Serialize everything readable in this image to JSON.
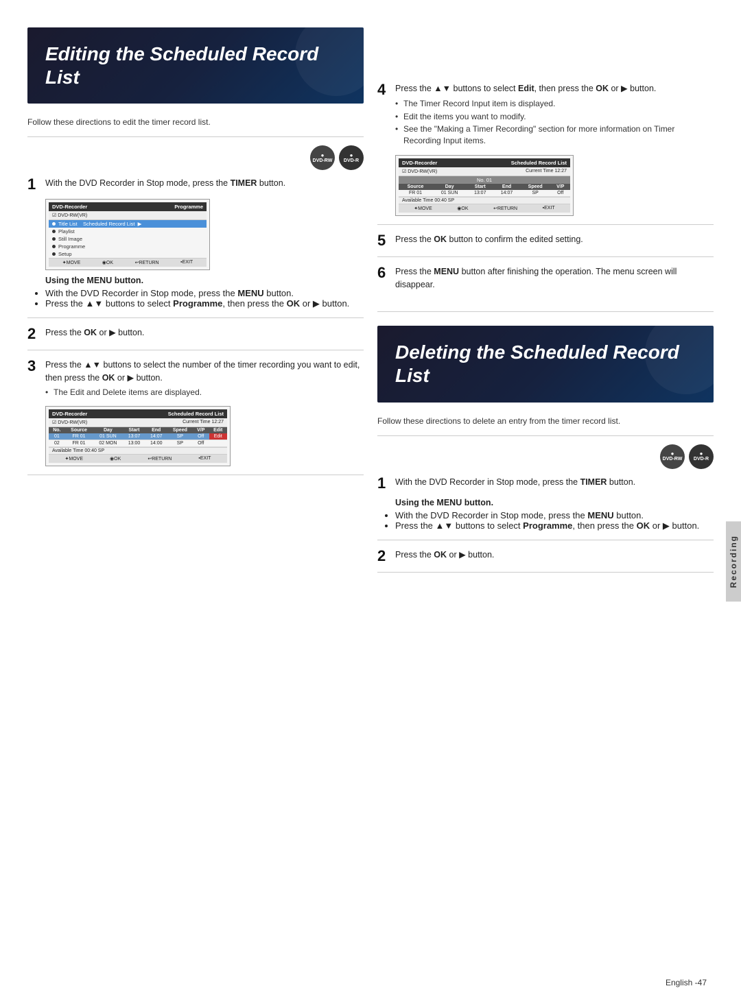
{
  "left": {
    "section_title": "Editing the Scheduled Record List",
    "intro": "Follow these directions to edit the timer record list.",
    "steps": [
      {
        "number": "1",
        "text": "With the DVD Recorder in Stop mode, press the ",
        "bold": "TIMER",
        "text2": " button."
      },
      {
        "number": "2",
        "text": "Press the ",
        "bold": "OK",
        "text2": " or ▶ button."
      },
      {
        "number": "3",
        "text": "Press the ▲▼ buttons to select the number of the timer recording you want to edit, then press the ",
        "bold": "OK",
        "text2": " or ▶ button.",
        "bullet": "The Edit and Delete items are displayed."
      }
    ],
    "using_menu": {
      "title": "Using the MENU button.",
      "bullets": [
        "With the DVD Recorder in Stop mode, press the MENU button.",
        "Press the ▲▼ buttons to select Programme, then press the OK or ▶ button."
      ]
    },
    "screen1": {
      "header_left": "DVD-Recorder",
      "header_right": "Programme",
      "subheader": "DVD-RW(VR)",
      "menu_items": [
        {
          "label": "Title List",
          "sub": "Scheduled Record List",
          "selected": true
        },
        {
          "label": "Playlist"
        },
        {
          "label": "Still Image"
        },
        {
          "label": "Programme"
        },
        {
          "label": "Setup"
        }
      ],
      "footer": [
        "MOVE",
        "OK",
        "RETURN",
        "EXIT"
      ]
    },
    "screen2": {
      "header_left": "DVD-Recorder",
      "header_right": "Scheduled Record List",
      "subheader_left": "DVD-RW(VR)",
      "subheader_right": "Current Time 12:27",
      "columns": [
        "No.",
        "Source",
        "Day",
        "Start",
        "End",
        "Speed",
        "V/P",
        "Edit"
      ],
      "rows": [
        [
          "01",
          "FR 01",
          "01 SUN",
          "13:07",
          "14:07",
          "SP",
          "Off",
          "Edit"
        ],
        [
          "02",
          "FR 01",
          "02 MON",
          "13:00",
          "14:00",
          "SP",
          "Off",
          ""
        ]
      ],
      "available": "Available Time 00:40 SP",
      "footer": [
        "MOVE",
        "OK",
        "RETURN",
        "EXIT"
      ]
    }
  },
  "right": {
    "steps_top": [
      {
        "number": "4",
        "text": "Press the ▲▼ buttons to select ",
        "bold": "Edit",
        "text2": ", then press the ",
        "bold2": "OK",
        "text3": " or ▶ button.",
        "bullets": [
          "The Timer Record Input item is displayed.",
          "Edit the items you want to modify.",
          "See the \"Making a Timer Recording\" section for more information on Timer Recording Input items."
        ]
      },
      {
        "number": "5",
        "text": "Press the ",
        "bold": "OK",
        "text2": " button to confirm the edited setting."
      },
      {
        "number": "6",
        "text": "Press the ",
        "bold": "MENU",
        "text2": " button after finishing the operation. The menu screen will disappear."
      }
    ],
    "screen3": {
      "header_left": "DVD-Recorder",
      "header_right": "Scheduled Record List",
      "subheader_left": "DVD-RW(VR)",
      "subheader_right": "Current Time 12:27",
      "no_label": "No. 01",
      "columns": [
        "Source",
        "Day",
        "Start",
        "End",
        "Speed",
        "V/P"
      ],
      "row": [
        "FR 01",
        "01 SUN",
        "13:07",
        "14:07",
        "SP",
        "Off"
      ],
      "available": "Available Time 00:40 SP",
      "footer": [
        "MOVE",
        "OK",
        "RETURN",
        "EXIT"
      ]
    },
    "section2": {
      "title": "Deleting the Scheduled Record List",
      "intro": "Follow these directions to delete an entry from the timer record list.",
      "steps": [
        {
          "number": "1",
          "text": "With the DVD Recorder in Stop mode, press the ",
          "bold": "TIMER",
          "text2": " button."
        },
        {
          "number": "2",
          "text": "Press the ",
          "bold": "OK",
          "text2": " or ▶ button."
        }
      ],
      "using_menu": {
        "title": "Using the MENU button.",
        "bullets": [
          "With the DVD Recorder in Stop mode, press the MENU button.",
          "Press the ▲▼ buttons to select Programme, then press the OK or ▶ button."
        ]
      }
    }
  },
  "icons": {
    "dvdrw_label": "DVD-RW",
    "dvdr_label": "DVD-R"
  },
  "recording_tab": "Recording",
  "page_number": "English -47"
}
